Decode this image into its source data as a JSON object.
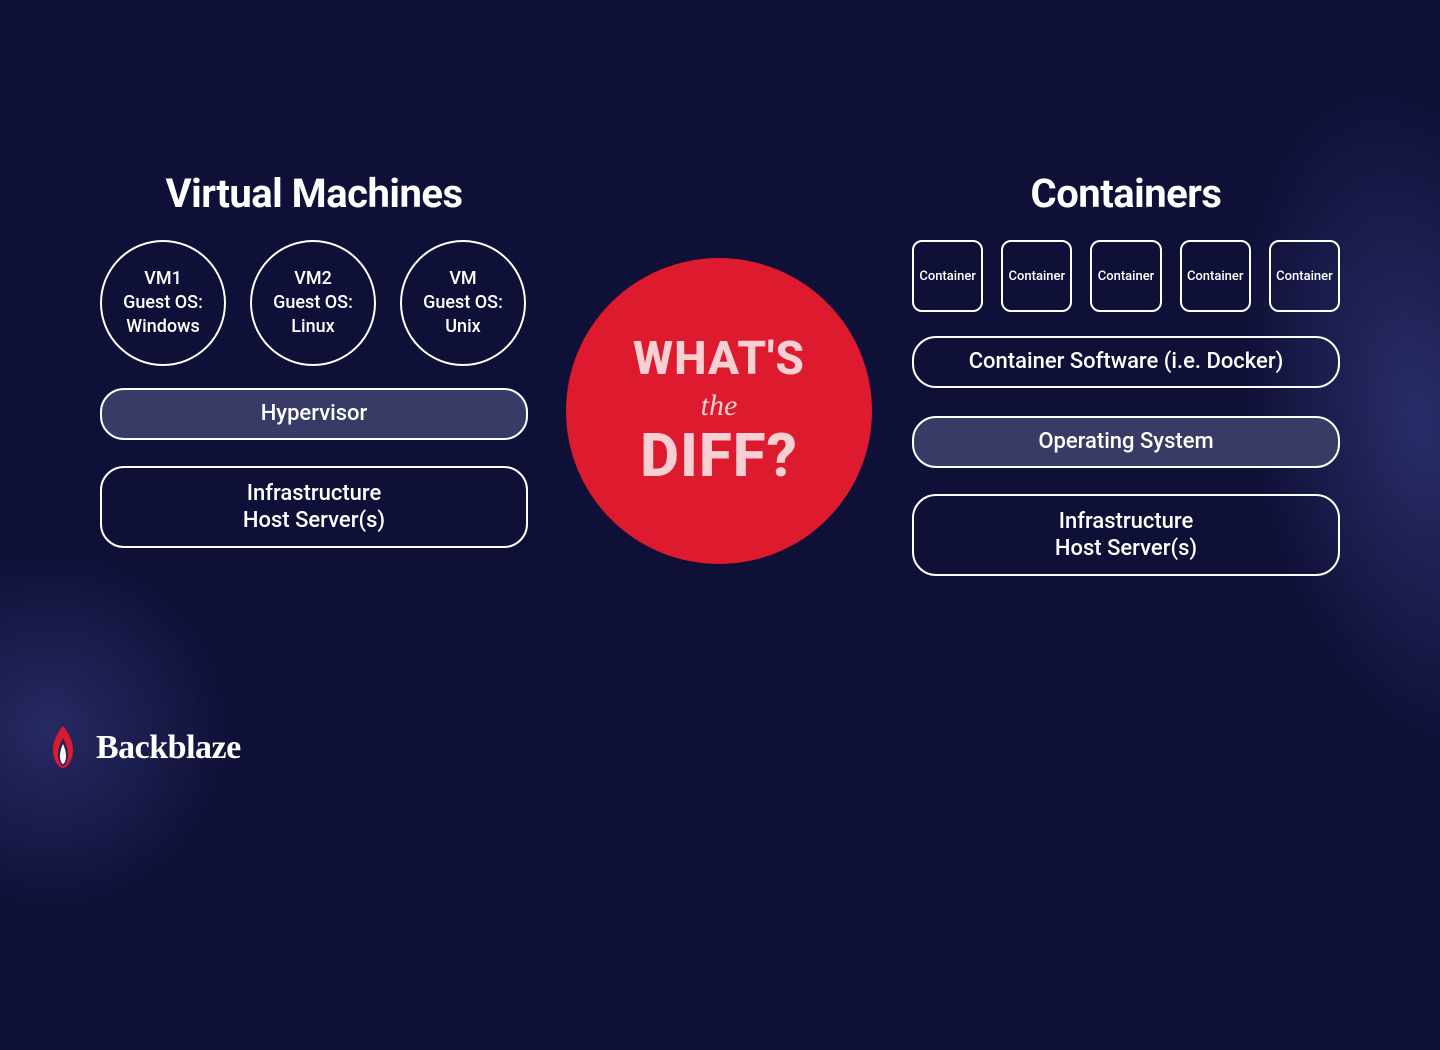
{
  "vm": {
    "heading": "Virtual Machines",
    "circles": [
      {
        "name": "VM1",
        "guest_label": "Guest OS:",
        "os": "Windows"
      },
      {
        "name": "VM2",
        "guest_label": "Guest OS:",
        "os": "Linux"
      },
      {
        "name": "VM",
        "guest_label": "Guest OS:",
        "os": "Unix"
      }
    ],
    "hypervisor": "Hypervisor",
    "infra_line1": "Infrastructure",
    "infra_line2": "Host Server(s)"
  },
  "badge": {
    "line1": "WHAT'S",
    "line2": "the",
    "line3": "DIFF?"
  },
  "ct": {
    "heading": "Containers",
    "boxes": [
      "Container",
      "Container",
      "Container",
      "Container",
      "Container"
    ],
    "software": "Container Software (i.e. Docker)",
    "os": "Operating System",
    "infra_line1": "Infrastructure",
    "infra_line2": "Host Server(s)"
  },
  "logo": {
    "name": "Backblaze",
    "accent_color": "#dd1a2e"
  }
}
